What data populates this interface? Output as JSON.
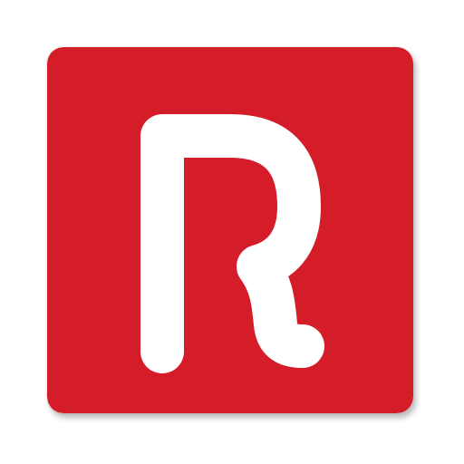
{
  "app_icon": {
    "icon": "letter-r-logo-icon",
    "letter": "R",
    "colors": {
      "tile": "#D51C29",
      "glyph": "#FFFFFF",
      "background": "#FFFFFF"
    }
  }
}
